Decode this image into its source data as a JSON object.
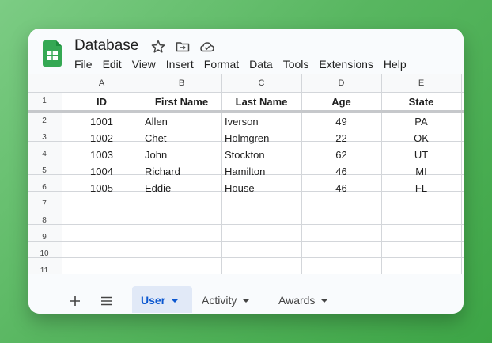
{
  "app": {
    "title": "Database"
  },
  "menu": [
    "File",
    "Edit",
    "View",
    "Insert",
    "Format",
    "Data",
    "Tools",
    "Extensions",
    "Help"
  ],
  "columns": [
    "A",
    "B",
    "C",
    "D",
    "E"
  ],
  "rows": [
    "1",
    "2",
    "3",
    "4",
    "5",
    "6",
    "7",
    "8",
    "9",
    "10",
    "11"
  ],
  "headers": [
    "ID",
    "First Name",
    "Last Name",
    "Age",
    "State"
  ],
  "records": [
    [
      "1001",
      "Allen",
      "Iverson",
      "49",
      "PA"
    ],
    [
      "1002",
      "Chet",
      "Holmgren",
      "22",
      "OK"
    ],
    [
      "1003",
      "John",
      "Stockton",
      "62",
      "UT"
    ],
    [
      "1004",
      "Richard",
      "Hamilton",
      "46",
      "MI"
    ],
    [
      "1005",
      "Eddie",
      "House",
      "46",
      "FL"
    ]
  ],
  "tabs": [
    {
      "label": "User",
      "active": true
    },
    {
      "label": "Activity",
      "active": false
    },
    {
      "label": "Awards",
      "active": false
    }
  ],
  "colors": {
    "active_tab": "#0b57d0",
    "logo": "#34a853",
    "background": "#4caf50"
  }
}
